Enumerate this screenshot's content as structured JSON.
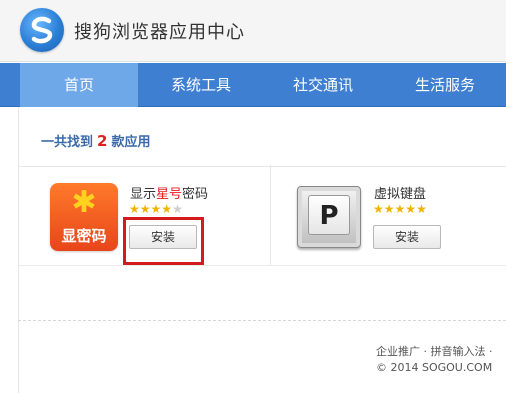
{
  "header": {
    "title": "搜狗浏览器应用中心"
  },
  "nav": {
    "items": [
      "首页",
      "系统工具",
      "社交通讯",
      "生活服务"
    ]
  },
  "summary": {
    "prefix": "一共找到",
    "count": "2",
    "suffix": "款应用"
  },
  "apps": [
    {
      "name_before": "显示",
      "name_highlight": "星号",
      "name_after": "密码",
      "icon_text": "显密码",
      "rating": 4,
      "max_rating": 5,
      "install_label": "安装"
    },
    {
      "name": "虚拟键盘",
      "icon_text": "P",
      "rating": 5,
      "max_rating": 5,
      "install_label": "安装"
    }
  ],
  "footer": {
    "links": "企业推广 · 拼音输入法 ·",
    "copyright": "© 2014 SOGOU.COM"
  },
  "colors": {
    "nav_bg": "#3f7fd2",
    "nav_active": "#6fa8e8",
    "highlight": "#e02020",
    "annotation_box": "#d31b1b"
  }
}
